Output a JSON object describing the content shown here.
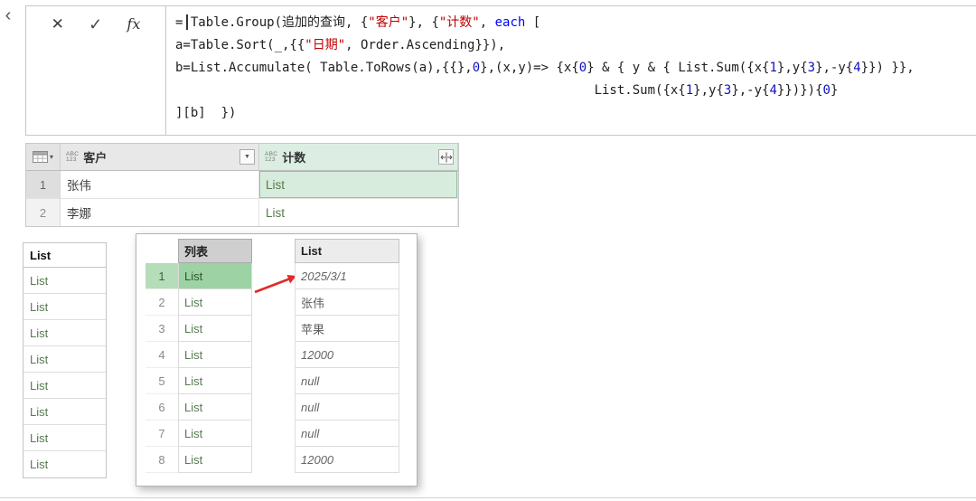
{
  "icons": {
    "collapse": "‹",
    "cancel": "✕",
    "check": "✓",
    "fx": "fx",
    "dropdown": "▼",
    "corner_dropdown": "▾"
  },
  "colors": {
    "string": "#c00000",
    "keyword": "#0000ff",
    "number": "#1010c0",
    "list_link": "#567b4f",
    "selection_green": "#9cd2a4",
    "cell_selected_green": "#d7ecdd",
    "header_selected_green": "#dceee3",
    "arrow_red": "#e02a2a"
  },
  "formula_bar": {
    "code_lines": [
      {
        "segments": [
          {
            "cls": "plain",
            "text": "= Table.Group(追加的查询, {"
          },
          {
            "cls": "string",
            "text": "\"客户\""
          },
          {
            "cls": "plain",
            "text": "}, {"
          },
          {
            "cls": "string",
            "text": "\"计数\""
          },
          {
            "cls": "plain",
            "text": ", "
          },
          {
            "cls": "keyword",
            "text": "each"
          },
          {
            "cls": "plain",
            "text": " ["
          }
        ]
      },
      {
        "segments": [
          {
            "cls": "plain",
            "text": "a=Table.Sort(_,{{"
          },
          {
            "cls": "string",
            "text": "\"日期\""
          },
          {
            "cls": "plain",
            "text": ", Order.Ascending}}),"
          }
        ]
      },
      {
        "segments": [
          {
            "cls": "plain",
            "text": "b=List.Accumulate( Table.ToRows(a),{{},"
          },
          {
            "cls": "number",
            "text": "0"
          },
          {
            "cls": "plain",
            "text": "},(x,y)=> {x{"
          },
          {
            "cls": "number",
            "text": "0"
          },
          {
            "cls": "plain",
            "text": "} & { y & { List.Sum({x{"
          },
          {
            "cls": "number",
            "text": "1"
          },
          {
            "cls": "plain",
            "text": "},y{"
          },
          {
            "cls": "number",
            "text": "3"
          },
          {
            "cls": "plain",
            "text": "},-y{"
          },
          {
            "cls": "number",
            "text": "4"
          },
          {
            "cls": "plain",
            "text": "}}) }},"
          }
        ]
      },
      {
        "segments": [
          {
            "cls": "plain",
            "text": "                                                       List.Sum({x{"
          },
          {
            "cls": "number",
            "text": "1"
          },
          {
            "cls": "plain",
            "text": "},y{"
          },
          {
            "cls": "number",
            "text": "3"
          },
          {
            "cls": "plain",
            "text": "},-y{"
          },
          {
            "cls": "number",
            "text": "4"
          },
          {
            "cls": "plain",
            "text": "}})}){"
          },
          {
            "cls": "number",
            "text": "0"
          },
          {
            "cls": "plain",
            "text": "}"
          }
        ]
      },
      {
        "segments": [
          {
            "cls": "plain",
            "text": "][b]  })"
          }
        ]
      }
    ]
  },
  "preview_table": {
    "columns": [
      {
        "type_badge_top": "ABC",
        "type_badge_bottom": "123",
        "name": "客户",
        "control": "filter",
        "selected": false
      },
      {
        "type_badge_top": "ABC",
        "type_badge_bottom": "123",
        "name": "计数",
        "control": "expand",
        "selected": true
      }
    ],
    "rows": [
      {
        "num": "1",
        "cells": [
          {
            "text": "张伟",
            "kind": "text",
            "selected": false
          },
          {
            "text": "List",
            "kind": "link",
            "selected": true
          }
        ]
      },
      {
        "num": "2",
        "cells": [
          {
            "text": "李娜",
            "kind": "text",
            "selected": false
          },
          {
            "text": "List",
            "kind": "link",
            "selected": false
          }
        ]
      }
    ]
  },
  "left_panel": {
    "header": "List",
    "rows": [
      "List",
      "List",
      "List",
      "List",
      "List",
      "List",
      "List",
      "List"
    ]
  },
  "popup": {
    "list_table": {
      "header": "列表",
      "rows": [
        {
          "num": "1",
          "text": "List",
          "selected": true
        },
        {
          "num": "2",
          "text": "List",
          "selected": false
        },
        {
          "num": "3",
          "text": "List",
          "selected": false
        },
        {
          "num": "4",
          "text": "List",
          "selected": false
        },
        {
          "num": "5",
          "text": "List",
          "selected": false
        },
        {
          "num": "6",
          "text": "List",
          "selected": false
        },
        {
          "num": "7",
          "text": "List",
          "selected": false
        },
        {
          "num": "8",
          "text": "List",
          "selected": false
        }
      ]
    },
    "values_table": {
      "header": "List",
      "rows": [
        {
          "text": "2025/3/1",
          "italic": true
        },
        {
          "text": "张伟",
          "italic": false
        },
        {
          "text": "苹果",
          "italic": false
        },
        {
          "text": "12000",
          "italic": true
        },
        {
          "text": "null",
          "italic": true
        },
        {
          "text": "null",
          "italic": true
        },
        {
          "text": "null",
          "italic": true
        },
        {
          "text": "12000",
          "italic": true
        }
      ]
    }
  }
}
